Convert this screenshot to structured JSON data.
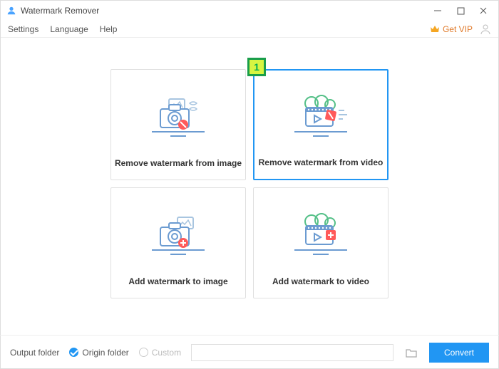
{
  "window": {
    "title": "Watermark Remover"
  },
  "menu": {
    "settings": "Settings",
    "language": "Language",
    "help": "Help",
    "vip": "Get VIP"
  },
  "cards": {
    "remove_image": "Remove watermark from image",
    "remove_video": "Remove watermark from video",
    "add_image": "Add watermark to image",
    "add_video": "Add watermark to video"
  },
  "step": {
    "number": "1"
  },
  "footer": {
    "output_label": "Output folder",
    "origin": "Origin folder",
    "custom": "Custom",
    "convert": "Convert"
  }
}
